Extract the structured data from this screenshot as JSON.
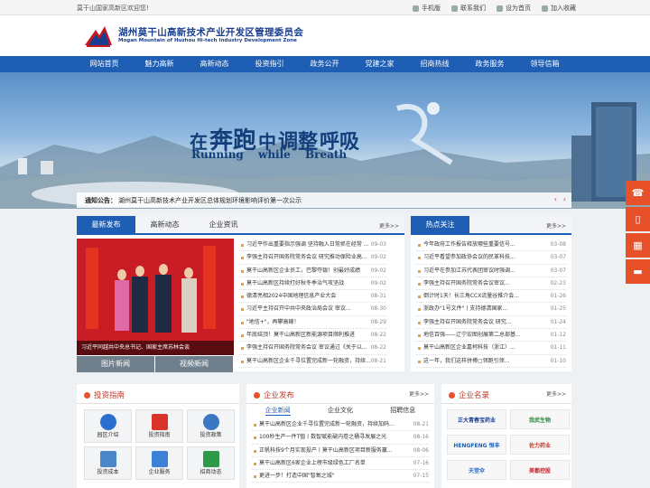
{
  "topbar": {
    "welcome": "莫干山国家高新区欢迎您!",
    "links": [
      "手机版",
      "联系我们",
      "设为首页",
      "加入收藏"
    ]
  },
  "header": {
    "title": "湖州莫干山高新技术产业开发区管理委员会",
    "subtitle": "Mogan Mountain of Huzhou Hi-tech Industry Development Zone"
  },
  "nav": [
    "网站首页",
    "魅力高新",
    "高新动态",
    "投资指引",
    "政务公开",
    "党建之家",
    "招商热线",
    "政务服务",
    "领导信箱"
  ],
  "banner": {
    "cn_1": "在",
    "cn_2": "奔跑",
    "cn_3": "中",
    "cn_4": "调整",
    "cn_5": "呼吸",
    "en": "Running while Breath"
  },
  "notice": {
    "label": "通知公告：",
    "text": "湖州莫干山高新技术产业开发区总体规划环境影响评价第一次公示"
  },
  "news": {
    "tabs": [
      "最新发布",
      "高新动态",
      "企业资讯"
    ],
    "more": "更多>>",
    "photo_caption": "习近平同越共中央总书记、国家主席苏林会谈",
    "photo_buttons": [
      "图片新闻",
      "视频新闻"
    ],
    "items": [
      {
        "title": "习近平作出重要指示强调 坚持融入日常抓在经常 ...",
        "date": "09-03"
      },
      {
        "title": "李强主持召开国务院常务会议 研究推动保险业高...",
        "date": "09-02"
      },
      {
        "title": "莫干山高新区企业员工，巴黎夺银！创最好成绩",
        "date": "09-02"
      },
      {
        "title": "莫干山高新区持续打好秋冬季治气攻坚战",
        "date": "09-02"
      },
      {
        "title": "德清亮相2024中国地理信息产业大会",
        "date": "08-31"
      },
      {
        "title": "习近平主持召开中共中央政治局会议 审议...",
        "date": "08-30"
      },
      {
        "title": "\"地信+\"，再攀高峰！",
        "date": "08-29"
      },
      {
        "title": "年底结顶！莫干山高新区新能源项目顺利推进",
        "date": "08-22"
      },
      {
        "title": "李强主持召开国务院常务会议 审议通过《关于以...",
        "date": "08-22"
      },
      {
        "title": "莫干山高新区企业千寻位置完成新一轮融资，持续...",
        "date": "08-21"
      }
    ]
  },
  "hot": {
    "title": "热点关注",
    "more": "更多>>",
    "items": [
      {
        "title": "今年政府工作报告释放哪些重要信号...",
        "date": "03-08"
      },
      {
        "title": "习近平看望参加政协会议的民革科技...",
        "date": "03-07"
      },
      {
        "title": "习近平在参加江苏代表团审议时强调...",
        "date": "03-07"
      },
      {
        "title": "李强主持召开国务院常务会议审议...",
        "date": "02-23"
      },
      {
        "title": "倒计时1天！长三角CCX流量谷推介会...",
        "date": "01-26"
      },
      {
        "title": "浙政办\"1号文件\"丨支持德清国家...",
        "date": "01-25"
      },
      {
        "title": "李强主持召开国务院常务会议 研究...",
        "date": "01-24"
      },
      {
        "title": "地信百强——辽宁宏图创展第二总部基...",
        "date": "01-12"
      },
      {
        "title": "莫干山高新区企业嘉柯科技（浙江）...",
        "date": "01-11"
      },
      {
        "title": "这一年，我们这样拼搏▢领跑引领...",
        "date": "01-10"
      }
    ]
  },
  "invest": {
    "title": "投资指南",
    "items": [
      "园区介绍",
      "投资指南",
      "投资政策",
      "投资成本",
      "企业服务",
      "招商动态"
    ]
  },
  "enterprise": {
    "title": "企业发布",
    "more": "更多>>",
    "tabs": [
      "企业新闻",
      "企业文化",
      "招聘信息"
    ],
    "items": [
      {
        "title": "莫干山高新区企业千寻位置完成新一轮融资，持续加码...",
        "date": "08-21"
      },
      {
        "title": "100秒生产一件T恤丨数智赋能破内卷之桶寻发展之光",
        "date": "08-16"
      },
      {
        "title": "正帆科技9个月实现投产丨莫干山高新区项目新服务赢...",
        "date": "08-06"
      },
      {
        "title": "莫干山高新区6家企业上榜市级绿色工厂名单",
        "date": "07-16"
      },
      {
        "title": "更进一步！打造中国\"智氧之城\"",
        "date": "07-15"
      }
    ]
  },
  "brands": {
    "title": "企业名录",
    "more": "更多>>",
    "items": [
      "正大青春宝药业",
      "我武生物",
      "HENGFENG 恒丰",
      "佐力药业",
      "天堂伞",
      "美都控股"
    ]
  }
}
